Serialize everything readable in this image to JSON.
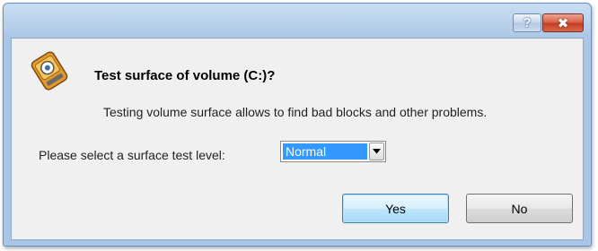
{
  "titlebar": {
    "help_label": "?",
    "close_label": "✖"
  },
  "dialog": {
    "icon": "volume-test-icon",
    "title": "Test surface of volume (C:)?",
    "description": "Testing volume surface allows to find bad blocks and other problems.",
    "select_label": "Please select a surface test level:",
    "test_level": {
      "selected": "Normal"
    },
    "buttons": {
      "yes": "Yes",
      "no": "No"
    }
  },
  "colors": {
    "selection": "#3399ff",
    "titlebar": "#b3cde9",
    "close_button": "#c43b22"
  }
}
